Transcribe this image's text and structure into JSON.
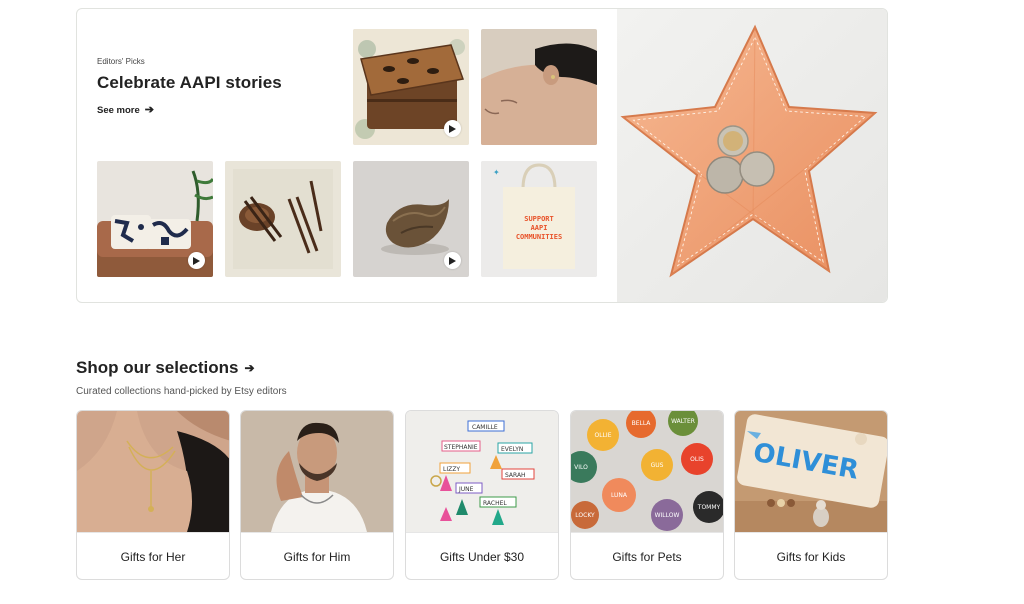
{
  "editors_picks": {
    "eyebrow": "Editors' Picks",
    "title": "Celebrate AAPI stories",
    "see_more": "See more",
    "tote_text": [
      "SUPPORT",
      "AAPI",
      "COMMUNITIES"
    ],
    "tiles": [
      {
        "name": "wooden-jewelry-box",
        "video": true
      },
      {
        "name": "ear-jewelry-portrait",
        "video": false
      },
      {
        "name": "patterned-pillows",
        "video": true
      },
      {
        "name": "wooden-chopsticks",
        "video": false
      },
      {
        "name": "ceramic-dumpling-dish",
        "video": true
      },
      {
        "name": "support-aapi-tote",
        "video": false
      },
      {
        "name": "star-leather-tray",
        "video": false
      }
    ]
  },
  "selections": {
    "title": "Shop our selections",
    "subtitle": "Curated collections hand-picked by Etsy editors",
    "cards": [
      {
        "label": "Gifts for Her"
      },
      {
        "label": "Gifts for Him"
      },
      {
        "label": "Gifts Under $30"
      },
      {
        "label": "Gifts for Pets"
      },
      {
        "label": "Gifts for Kids"
      }
    ],
    "keychain_names": [
      "CAMILLE",
      "STEPHANIE",
      "EVELYN",
      "LIZZY",
      "SARAH",
      "JUNE",
      "RACHEL"
    ],
    "pet_tag_names": [
      "OLLIE",
      "BELLA",
      "WALTER",
      "VILO",
      "GUS",
      "OLIS",
      "LUNA",
      "WILLOW",
      "TOMMY",
      "LOCKY"
    ],
    "kids_puzzle_name": "OLIVER"
  },
  "colors": {
    "text": "#222222",
    "border": "#e1e3df",
    "star_tray": "#f2a47c"
  }
}
